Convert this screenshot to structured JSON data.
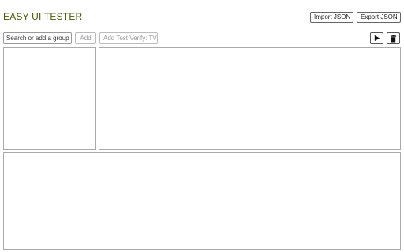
{
  "app": {
    "title": "EASY UI TESTER"
  },
  "toolbar": {
    "import_label": "Import JSON",
    "export_label": "Export JSON"
  },
  "controls": {
    "search_placeholder": "Search or add a group",
    "add_label": "Add",
    "add_test_label": "Add Test Verify: TV",
    "play_icon": "play-icon",
    "delete_icon": "trash-icon"
  },
  "colors": {
    "title": "#4a5a00",
    "border": "#aaaaaa"
  }
}
